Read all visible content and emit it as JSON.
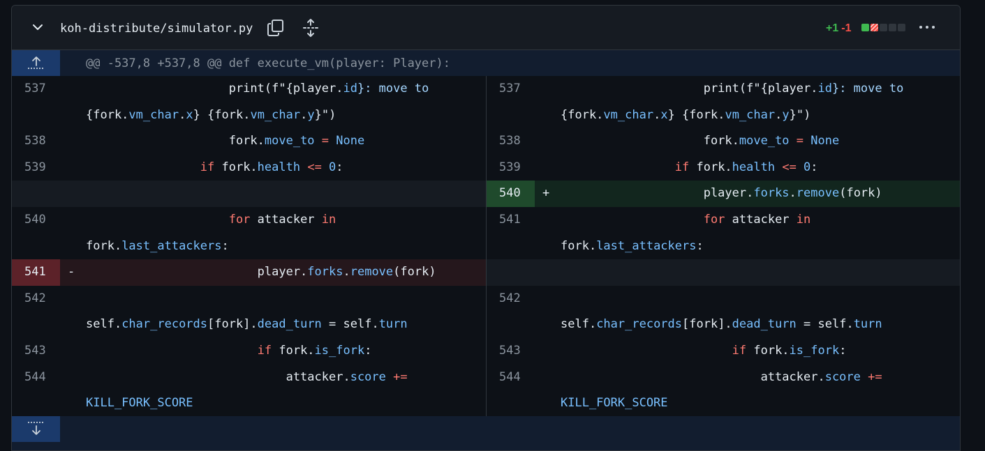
{
  "file": {
    "path": "koh-distribute/simulator.py",
    "additions": "+1",
    "deletions": "-1",
    "stat_colors": [
      "#3fb950",
      "#f85149",
      "#30363d",
      "#30363d",
      "#30363d"
    ]
  },
  "icons": {
    "collapse": "chevron-down-icon",
    "copy": "copy-icon",
    "expand_all": "unfold-icon",
    "more": "kebab-horizontal-icon",
    "expand_up": "fold-up-icon",
    "expand_down": "fold-down-icon"
  },
  "hunk": {
    "header": "@@ -537,8 +537,8 @@ def execute_vm(player: Player):"
  },
  "left": {
    "lines": [
      "537",
      "538",
      "539",
      "540",
      "541",
      "542",
      "543",
      "544"
    ]
  },
  "right": {
    "lines": [
      "537",
      "538",
      "539",
      "540",
      "541",
      "542",
      "543",
      "544"
    ]
  },
  "code": {
    "l537a": "print(f\"{player.",
    "l537b": "id",
    "l537c": "}: move to",
    "l537d": "{fork.",
    "l537e": "vm_char",
    "l537f": ".",
    "l537g": "x",
    "l537h": "} {fork.",
    "l537i": "vm_char",
    "l537j": ".",
    "l537k": "y",
    "l537l": "}\")",
    "l538a": "fork.",
    "l538b": "move_to",
    "l538c": " = ",
    "l538d": "None",
    "l539a": "if",
    "l539b": " fork.",
    "l539c": "health",
    "l539d": " <= ",
    "l539e": "0",
    "l539f": ":",
    "rm_a": "player.",
    "rm_b": "forks",
    "rm_c": ".",
    "rm_d": "remove",
    "rm_e": "(fork)",
    "for_a": "for",
    "for_b": " attacker ",
    "for_c": "in",
    "la_a": "fork.",
    "la_b": "last_attackers",
    "la_c": ":",
    "sc_a": "self.",
    "sc_b": "char_records",
    "sc_c": "[fork].",
    "sc_d": "dead_turn",
    "sc_e": " = self.",
    "sc_f": "turn",
    "if2_a": "if",
    "if2_b": " fork.",
    "if2_c": "is_fork",
    "if2_d": ":",
    "at_a": "attacker.",
    "at_b": "score",
    "at_c": " +=",
    "kfs": "KILL_FORK_SCORE",
    "plus": "+",
    "minus": "-"
  }
}
